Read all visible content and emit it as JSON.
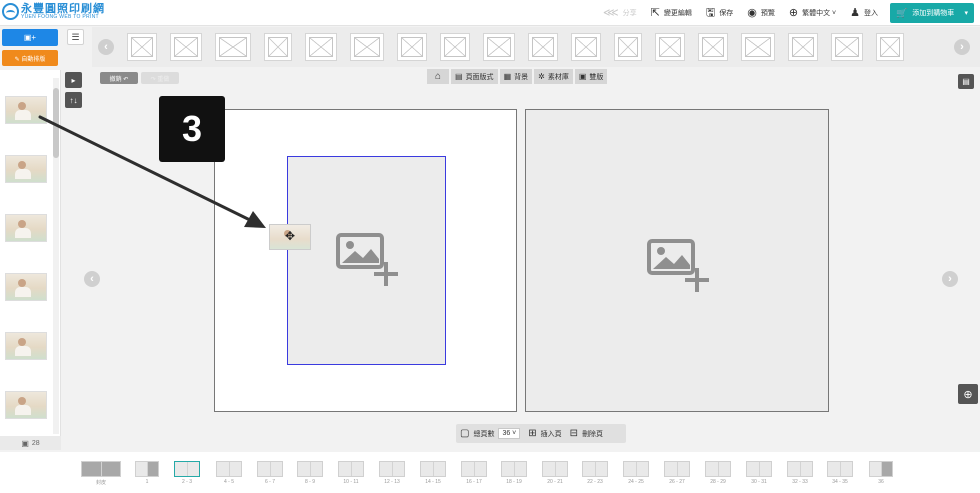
{
  "header": {
    "logo_cn": "永豐圓照印刷網",
    "logo_en": "YUEN FOONG WEB TO PRINT",
    "tools": [
      {
        "icon": "share-icon",
        "glyph": "⋘",
        "label": "分享",
        "disabled": true
      },
      {
        "icon": "export-icon",
        "glyph": "⇱",
        "label": "變更編輯",
        "disabled": false
      },
      {
        "icon": "save-icon",
        "glyph": "🖫",
        "label": "保存",
        "disabled": false
      },
      {
        "icon": "eye-icon",
        "glyph": "◉",
        "label": "預覽",
        "disabled": false
      },
      {
        "icon": "globe-icon",
        "glyph": "⊕",
        "label": "繁體中文 ˅",
        "disabled": false
      },
      {
        "icon": "user-icon",
        "glyph": "♟",
        "label": "登入",
        "disabled": false
      }
    ],
    "cart_label": "添加到購物車",
    "cart_caret": "▾"
  },
  "left_actions": {
    "add_photo_label": "▣+",
    "auto_fill_label": "✎ 自動排版",
    "list_toggle_glyph": "☰"
  },
  "layout_strip": {
    "prev": "‹",
    "next": "›",
    "count": 27
  },
  "photo_panel": {
    "count": 6,
    "photo_count_label": "28",
    "collapse_glyph": "▸",
    "sort_glyph": "↑↓"
  },
  "edit_toolbar": {
    "undo_label": "撤銷 ↶",
    "redo_label": "↷ 重做",
    "tabs": [
      {
        "name": "home",
        "icon": "⌂",
        "label": ""
      },
      {
        "name": "page-layout",
        "icon": "▤",
        "label": "頁面版式"
      },
      {
        "name": "background",
        "icon": "▦",
        "label": "背景"
      },
      {
        "name": "materials",
        "icon": "✲",
        "label": "素材庫"
      },
      {
        "name": "frame",
        "icon": "▣",
        "label": "雙版"
      }
    ],
    "right_icon_glyph": "▤"
  },
  "canvas": {
    "prev": "‹",
    "next": "›",
    "step_number": "3",
    "cursor_glyph": "✥"
  },
  "zoom": {
    "glyph": "⊕"
  },
  "page_bar": {
    "page_count_label": "總頁數",
    "page_count_value": "36 ˅",
    "insert_label": "插入頁",
    "delete_label": "刪除頁",
    "page_icon": "▢",
    "insert_icon": "⊞",
    "delete_icon": "⊟"
  },
  "page_strip": {
    "pages": [
      {
        "label": "封皮",
        "type": "cover"
      },
      {
        "label": "1",
        "type": "single"
      },
      {
        "label": "2 - 3",
        "type": "spread",
        "active": true
      },
      {
        "label": "4 - 5",
        "type": "spread"
      },
      {
        "label": "6 - 7",
        "type": "spread"
      },
      {
        "label": "8 - 9",
        "type": "spread"
      },
      {
        "label": "10 - 11",
        "type": "spread"
      },
      {
        "label": "12 - 13",
        "type": "spread"
      },
      {
        "label": "14 - 15",
        "type": "spread"
      },
      {
        "label": "16 - 17",
        "type": "spread"
      },
      {
        "label": "18 - 19",
        "type": "spread"
      },
      {
        "label": "20 - 21",
        "type": "spread"
      },
      {
        "label": "22 - 23",
        "type": "spread"
      },
      {
        "label": "24 - 25",
        "type": "spread"
      },
      {
        "label": "26 - 27",
        "type": "spread"
      },
      {
        "label": "28 - 29",
        "type": "spread"
      },
      {
        "label": "30 - 31",
        "type": "spread"
      },
      {
        "label": "32 - 33",
        "type": "spread"
      },
      {
        "label": "34 - 35",
        "type": "spread"
      },
      {
        "label": "36",
        "type": "last"
      }
    ]
  },
  "colors": {
    "primary_teal": "#18a9a7",
    "add_blue": "#1e87e6",
    "auto_orange": "#f08a1c",
    "frame_border": "#3a3adf"
  }
}
